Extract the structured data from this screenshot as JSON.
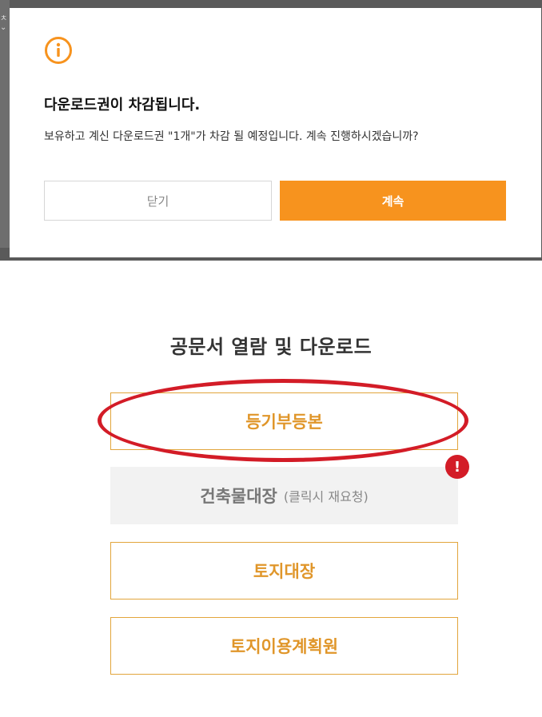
{
  "modal": {
    "icon": "info-circle-icon",
    "title": "다운로드권이 차감됩니다.",
    "message": "보유하고 계신 다운로드권 \"1개\"가 차감 될 예정입니다. 계속 진행하시겠습니까?",
    "close_label": "닫기",
    "continue_label": "계속",
    "accent_color": "#f7931e"
  },
  "documents": {
    "title": "공문서 열람 및 다운로드",
    "items": [
      {
        "label": "등기부등본"
      },
      {
        "label": "건축물대장",
        "note": "(클릭시 재요청)"
      },
      {
        "label": "토지대장"
      },
      {
        "label": "토지이용계획원"
      }
    ],
    "highlight_color": "#d31c27",
    "alert_icon": "exclamation-badge-icon"
  }
}
